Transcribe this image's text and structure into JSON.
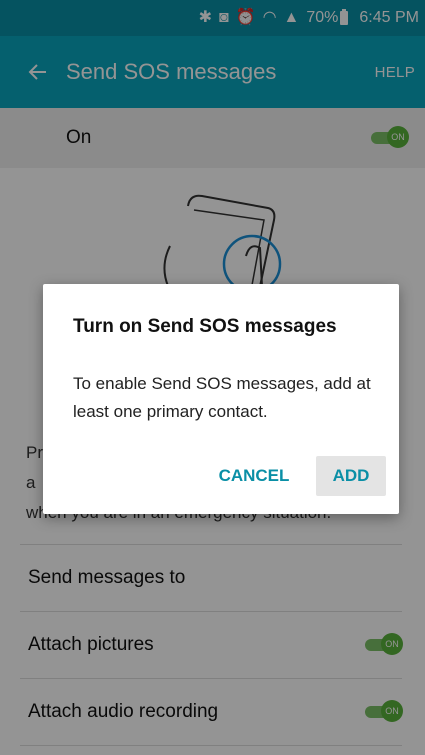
{
  "status_bar": {
    "battery": "70%",
    "time": "6:45 PM"
  },
  "app_bar": {
    "title": "Send SOS messages",
    "help": "HELP"
  },
  "master_switch": {
    "label": "On",
    "state": "ON"
  },
  "description": {
    "line1_start": "Pr",
    "line1_end": "d",
    "line2_start": "a",
    "line3": "when you are in an emergency situation."
  },
  "settings": [
    {
      "label": "Send messages to"
    },
    {
      "label": "Attach pictures",
      "switch": "ON"
    },
    {
      "label": "Attach audio recording",
      "switch": "ON"
    }
  ],
  "dialog": {
    "title": "Turn on Send SOS messages",
    "message": "To enable Send SOS messages, add at least one primary contact.",
    "cancel": "CANCEL",
    "add": "ADD"
  },
  "colors": {
    "status_bar": "#0a8fa6",
    "app_bar": "#0aa5bd",
    "switch_on": "#58b13b",
    "dialog_button_text": "#0a8fa6"
  }
}
